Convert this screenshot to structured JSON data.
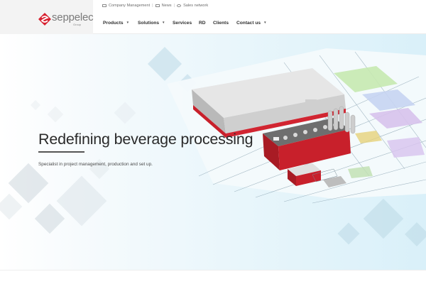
{
  "brand": {
    "name": "seppelec",
    "sub": "Group",
    "colors": {
      "red": "#d7202f",
      "gray": "#7a7a7a"
    }
  },
  "topbar": {
    "items": [
      {
        "label": "Company Management",
        "icon": "document-icon"
      },
      {
        "label": "News",
        "icon": "newspaper-icon"
      },
      {
        "label": "Sales network",
        "icon": "eye-icon"
      }
    ]
  },
  "nav": {
    "items": [
      {
        "label": "Products",
        "has_dropdown": true
      },
      {
        "label": "Solutions",
        "has_dropdown": true
      },
      {
        "label": "Services",
        "has_dropdown": false
      },
      {
        "label": "RD",
        "has_dropdown": false
      },
      {
        "label": "Clients",
        "has_dropdown": false
      },
      {
        "label": "Contact us",
        "has_dropdown": true
      }
    ]
  },
  "hero": {
    "title": "Redefining beverage processing",
    "subtitle": "Specialist in project management, production and set up.",
    "image": "factory-3d-plan-illustration",
    "colors": {
      "bg": "#e4f4fa",
      "accent_red": "#c8202b"
    }
  }
}
